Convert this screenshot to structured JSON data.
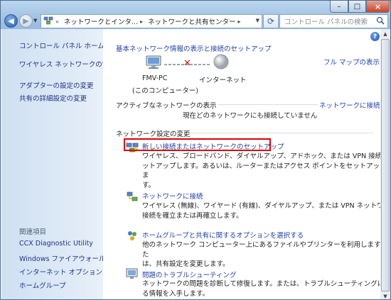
{
  "window": {
    "close_glyph": "×",
    "minimize_glyph": "–",
    "maximize_glyph": "□"
  },
  "address_bar": {
    "segments": [
      "ネットワークとインタ...",
      "ネットワークと共有センター"
    ],
    "separator_glyph": "▸",
    "prefix_glyph": "«"
  },
  "search": {
    "placeholder": "コントロール パネルの検索"
  },
  "sidebar": {
    "home": "コントロール パネル ホーム",
    "items": [
      "ワイヤレス ネットワークの管理",
      "アダプターの設定の変更",
      "共有の詳細設定の変更"
    ],
    "related_heading": "関連項目",
    "related": [
      "CCX Diagnostic Utility",
      "Windows ファイアウォール",
      "インターネット オプション",
      "ホームグループ"
    ]
  },
  "main": {
    "header_link": "基本ネットワーク情報の表示と接続のセットアップ",
    "full_map_link": "フル マップの表示",
    "computer_name": "FMV-PC",
    "computer_sub": "(このコンピューター)",
    "internet_label": "インターネット",
    "active_networks_label": "アクティブなネットワークの表示",
    "connect_link": "ネットワークに接続",
    "no_connection": "現在どのネットワークにも接続していません",
    "settings_heading": "ネットワーク設定の変更",
    "tasks": [
      {
        "title": "新しい接続またはネットワークのセットアップ",
        "desc": [
          "ワイヤレス、ブロードバンド、ダイヤルアップ、アドホック、または VPN 接続をセ",
          "ットアップします。あるいは、ルーターまたはアクセス ポイントをセットアップしま",
          "す。"
        ],
        "icon": "network-setup-icon"
      },
      {
        "title": "ネットワークに接続",
        "desc": [
          "ワイヤレス (無線)、ワイヤード (有線)、ダイヤルアップ、または VPN ネットワーク",
          "接続を確立または再確立します。"
        ],
        "icon": "network-connect-icon"
      },
      {
        "title": "ホームグループと共有に関するオプションを選択する",
        "desc": [
          "他のネットワーク コンピューター上にあるファイルやプリンターを利用します。また",
          "は、共有設定を変更します。"
        ],
        "icon": "homegroup-icon"
      },
      {
        "title": "問題のトラブルシューティング",
        "desc": [
          "ネットワークの問題を診断して修復します。または、トラブルシューティングに関す",
          "る情報を入手します。"
        ],
        "icon": "troubleshoot-icon"
      }
    ]
  },
  "colors": {
    "link": "#1f3ea1",
    "highlight": "#e00000",
    "sidebar_link": "#1e3287"
  }
}
